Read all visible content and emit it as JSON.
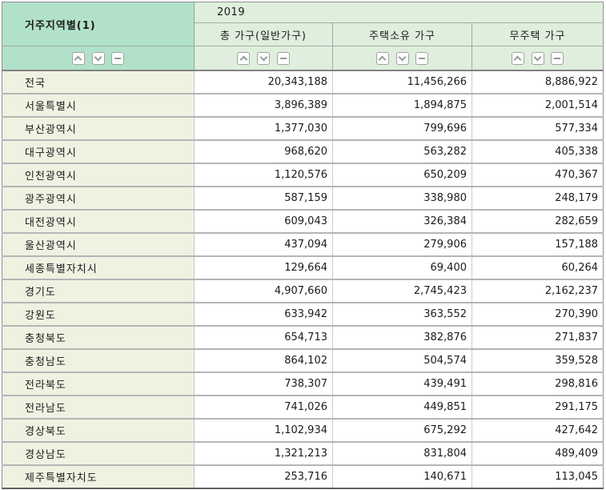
{
  "table": {
    "corner_header": "거주지역별(1)",
    "year_header": "2019",
    "columns": [
      "총 가구(일반가구)",
      "주택소유 가구",
      "무주택 가구"
    ],
    "sort_controls": {
      "ascending_icon": "chevron-up",
      "descending_icon": "chevron-down",
      "clear_icon": "minus"
    },
    "rows": [
      {
        "region": "전국",
        "values": [
          "20,343,188",
          "11,456,266",
          "8,886,922"
        ]
      },
      {
        "region": "서울특별시",
        "values": [
          "3,896,389",
          "1,894,875",
          "2,001,514"
        ]
      },
      {
        "region": "부산광역시",
        "values": [
          "1,377,030",
          "799,696",
          "577,334"
        ]
      },
      {
        "region": "대구광역시",
        "values": [
          "968,620",
          "563,282",
          "405,338"
        ]
      },
      {
        "region": "인천광역시",
        "values": [
          "1,120,576",
          "650,209",
          "470,367"
        ]
      },
      {
        "region": "광주광역시",
        "values": [
          "587,159",
          "338,980",
          "248,179"
        ]
      },
      {
        "region": "대전광역시",
        "values": [
          "609,043",
          "326,384",
          "282,659"
        ]
      },
      {
        "region": "울산광역시",
        "values": [
          "437,094",
          "279,906",
          "157,188"
        ]
      },
      {
        "region": "세종특별자치시",
        "values": [
          "129,664",
          "69,400",
          "60,264"
        ]
      },
      {
        "region": "경기도",
        "values": [
          "4,907,660",
          "2,745,423",
          "2,162,237"
        ]
      },
      {
        "region": "강원도",
        "values": [
          "633,942",
          "363,552",
          "270,390"
        ]
      },
      {
        "region": "충청북도",
        "values": [
          "654,713",
          "382,876",
          "271,837"
        ]
      },
      {
        "region": "충청남도",
        "values": [
          "864,102",
          "504,574",
          "359,528"
        ]
      },
      {
        "region": "전라북도",
        "values": [
          "738,307",
          "439,491",
          "298,816"
        ]
      },
      {
        "region": "전라남도",
        "values": [
          "741,026",
          "449,851",
          "291,175"
        ]
      },
      {
        "region": "경상북도",
        "values": [
          "1,102,934",
          "675,292",
          "427,642"
        ]
      },
      {
        "region": "경상남도",
        "values": [
          "1,321,213",
          "831,804",
          "489,409"
        ]
      },
      {
        "region": "제주특별자치도",
        "values": [
          "253,716",
          "140,671",
          "113,045"
        ]
      }
    ],
    "colors": {
      "corner_header_bg": "#b1e2c9",
      "column_header_bg": "#dfeedd",
      "row_label_bg": "#f1f1e2",
      "row_border": "#b5b5b5",
      "header_divider": "#828282"
    }
  }
}
